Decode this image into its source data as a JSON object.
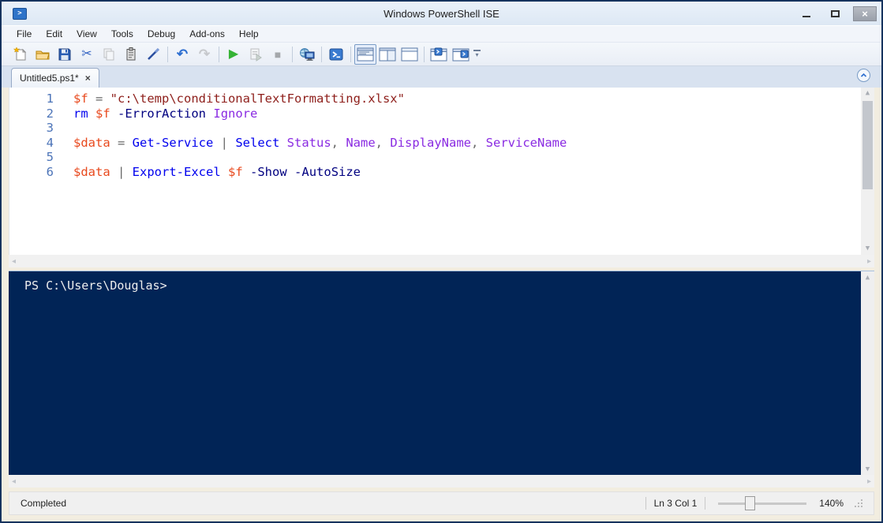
{
  "window": {
    "title": "Windows PowerShell ISE",
    "app_icon": ">",
    "controls": {
      "minimize": "minimize",
      "maximize": "maximize",
      "close": "×"
    }
  },
  "menu_items": [
    "File",
    "Edit",
    "View",
    "Tools",
    "Debug",
    "Add-ons",
    "Help"
  ],
  "toolbar_icons": [
    "new-script-icon",
    "open-script-icon",
    "save-icon",
    "cut-icon",
    "copy-icon",
    "paste-icon",
    "clear-console-icon",
    "undo-icon",
    "redo-icon",
    "run-script-icon",
    "run-selection-icon",
    "stop-operation-icon",
    "new-remote-powershell-tab-icon",
    "start-powershell-icon",
    "show-script-pane-top-icon",
    "show-script-pane-right-icon",
    "show-script-pane-maximized-icon",
    "script-pane-tab-icon",
    "script-pane-tab-right-icon",
    "toolbar-overflow-icon"
  ],
  "toolbar_glyphs": {
    "cut": "✂",
    "undo": "↶",
    "redo": "↷",
    "run": "▶",
    "stop": "■"
  },
  "tab": {
    "label": "Untitled5.ps1*",
    "close": "×"
  },
  "editor": {
    "lines": [
      {
        "n": "1",
        "tokens": [
          {
            "c": "var",
            "t": "$f"
          },
          {
            "c": "op",
            "t": " = "
          },
          {
            "c": "str",
            "t": "\"c:\\temp\\conditionalTextFormatting.xlsx\""
          }
        ]
      },
      {
        "n": "2",
        "tokens": [
          {
            "c": "cmd",
            "t": "rm"
          },
          {
            "c": "pl",
            "t": " "
          },
          {
            "c": "var",
            "t": "$f"
          },
          {
            "c": "pl",
            "t": " "
          },
          {
            "c": "param",
            "t": "-ErrorAction"
          },
          {
            "c": "pl",
            "t": " "
          },
          {
            "c": "arg",
            "t": "Ignore"
          }
        ]
      },
      {
        "n": "3",
        "tokens": []
      },
      {
        "n": "4",
        "tokens": [
          {
            "c": "var",
            "t": "$data"
          },
          {
            "c": "op",
            "t": " = "
          },
          {
            "c": "cmd",
            "t": "Get-Service"
          },
          {
            "c": "op",
            "t": " | "
          },
          {
            "c": "cmd",
            "t": "Select"
          },
          {
            "c": "pl",
            "t": " "
          },
          {
            "c": "arg",
            "t": "Status"
          },
          {
            "c": "op",
            "t": ", "
          },
          {
            "c": "arg",
            "t": "Name"
          },
          {
            "c": "op",
            "t": ", "
          },
          {
            "c": "arg",
            "t": "DisplayName"
          },
          {
            "c": "op",
            "t": ", "
          },
          {
            "c": "arg",
            "t": "ServiceName"
          }
        ]
      },
      {
        "n": "5",
        "tokens": []
      },
      {
        "n": "6",
        "tokens": [
          {
            "c": "var",
            "t": "$data"
          },
          {
            "c": "op",
            "t": " | "
          },
          {
            "c": "cmd",
            "t": "Export-Excel"
          },
          {
            "c": "pl",
            "t": " "
          },
          {
            "c": "var",
            "t": "$f"
          },
          {
            "c": "pl",
            "t": " "
          },
          {
            "c": "param",
            "t": "-Show"
          },
          {
            "c": "pl",
            "t": " "
          },
          {
            "c": "param",
            "t": "-AutoSize"
          }
        ]
      }
    ]
  },
  "console": {
    "prompt": "PS C:\\Users\\Douglas>"
  },
  "status": {
    "state": "Completed",
    "line_col": "Ln 3 Col 1",
    "zoom": "140%"
  },
  "colors": {
    "window_border": "#16335e",
    "console_bg": "#012456",
    "console_text": "#eeeeee",
    "token_variable": "#e8491d",
    "token_string": "#8e1f1b",
    "token_command": "#0000ee",
    "token_parameter": "#000080",
    "token_argument": "#8a2be2",
    "token_operator": "#696969",
    "line_number": "#4c74b8",
    "run_green": "#35b335"
  }
}
